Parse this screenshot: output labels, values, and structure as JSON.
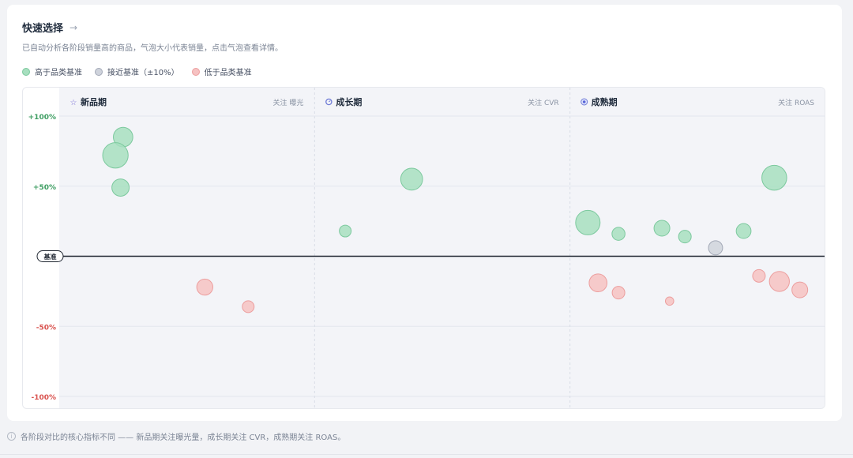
{
  "header": {
    "title": "快速选择",
    "arrow": "→"
  },
  "subtitle": "已自动分析各阶段销量高的商品，气泡大小代表销量，点击气泡查看详情。",
  "colors": {
    "above": "#a7dfbf",
    "above_stroke": "#7cc99e",
    "near": "#cfd3dc",
    "near_stroke": "#a3a9b7",
    "below": "#f6c2c2",
    "below_stroke": "#ec9e9e",
    "positive_tick": "#3f9e63",
    "negative_tick": "#d9534f",
    "baseline": "#1e2530"
  },
  "legend": [
    {
      "key": "above",
      "label": "高于品类基准",
      "color": "#a7dfbf"
    },
    {
      "key": "near",
      "label": "接近基准（±10%）",
      "color": "#cfd3dc"
    },
    {
      "key": "below",
      "label": "低于品类基准",
      "color": "#f6c2c2"
    }
  ],
  "footer": "各阶段对比的核心指标不同 —— 新品期关注曝光量，成长期关注 CVR，成熟期关注 ROAS。",
  "chart_data": {
    "type": "scatter",
    "ylim": [
      -100,
      100
    ],
    "yticks": [
      {
        "value": 100,
        "label": "+100%"
      },
      {
        "value": 50,
        "label": "+50%"
      },
      {
        "value": -50,
        "label": "-50%"
      },
      {
        "value": -100,
        "label": "-100%"
      }
    ],
    "baseline_label": "基准",
    "panels": [
      {
        "name": "新品期",
        "icon": "star-icon",
        "focus": "关注 曝光",
        "points": [
          {
            "x": 0.25,
            "y": 85,
            "size": 38,
            "status": "above"
          },
          {
            "x": 0.22,
            "y": 72,
            "size": 65,
            "status": "above"
          },
          {
            "x": 0.24,
            "y": 49,
            "size": 30,
            "status": "above"
          },
          {
            "x": 0.57,
            "y": -22,
            "size": 26,
            "status": "below"
          },
          {
            "x": 0.74,
            "y": -36,
            "size": 14,
            "status": "below"
          }
        ]
      },
      {
        "name": "成长期",
        "icon": "clock-icon",
        "focus": "关注 CVR",
        "points": [
          {
            "x": 0.12,
            "y": 18,
            "size": 14,
            "status": "above"
          },
          {
            "x": 0.38,
            "y": 55,
            "size": 48,
            "status": "above"
          }
        ]
      },
      {
        "name": "成熟期",
        "icon": "target-icon",
        "focus": "关注 ROAS",
        "points": [
          {
            "x": 0.07,
            "y": 24,
            "size": 60,
            "status": "above"
          },
          {
            "x": 0.19,
            "y": 16,
            "size": 17,
            "status": "above"
          },
          {
            "x": 0.36,
            "y": 20,
            "size": 25,
            "status": "above"
          },
          {
            "x": 0.45,
            "y": 14,
            "size": 16,
            "status": "above"
          },
          {
            "x": 0.57,
            "y": 6,
            "size": 20,
            "status": "near"
          },
          {
            "x": 0.68,
            "y": 18,
            "size": 22,
            "status": "above"
          },
          {
            "x": 0.8,
            "y": 56,
            "size": 62,
            "status": "above"
          },
          {
            "x": 0.11,
            "y": -19,
            "size": 32,
            "status": "below"
          },
          {
            "x": 0.19,
            "y": -26,
            "size": 16,
            "status": "below"
          },
          {
            "x": 0.39,
            "y": -32,
            "size": 7,
            "status": "below"
          },
          {
            "x": 0.74,
            "y": -14,
            "size": 16,
            "status": "below"
          },
          {
            "x": 0.82,
            "y": -18,
            "size": 40,
            "status": "below"
          },
          {
            "x": 0.9,
            "y": -24,
            "size": 25,
            "status": "below"
          }
        ]
      }
    ]
  }
}
